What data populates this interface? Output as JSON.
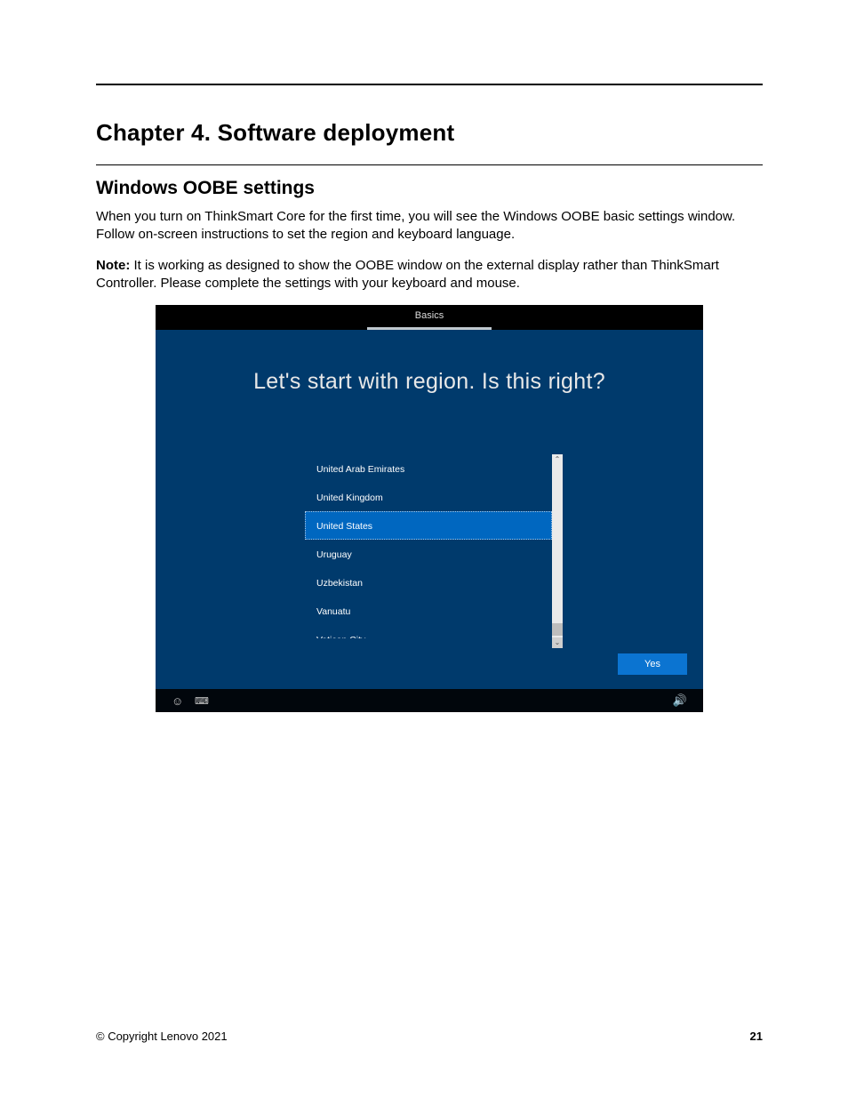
{
  "chapter_title": "Chapter 4.   Software deployment",
  "section_title": "Windows OOBE settings",
  "paragraph1": "When you turn on ThinkSmart Core for the first time, you will see the Windows OOBE basic settings window. Follow on-screen instructions to set the region and keyboard language.",
  "note_label": "Note:",
  "note_body": "  It is working as designed to show the OOBE window on the external display rather than ThinkSmart Controller. Please complete the settings with your keyboard and mouse.",
  "oobe": {
    "tab": "Basics",
    "heading": "Let's start with region. Is this right?",
    "regions": [
      {
        "label": "United Arab Emirates",
        "selected": false
      },
      {
        "label": "United Kingdom",
        "selected": false
      },
      {
        "label": "United States",
        "selected": true
      },
      {
        "label": "Uruguay",
        "selected": false
      },
      {
        "label": "Uzbekistan",
        "selected": false
      },
      {
        "label": "Vanuatu",
        "selected": false
      },
      {
        "label": "Vatican City",
        "selected": false,
        "partial": true
      }
    ],
    "yes_button": "Yes"
  },
  "footer": {
    "copyright": "© Copyright Lenovo 2021",
    "page": "21"
  }
}
